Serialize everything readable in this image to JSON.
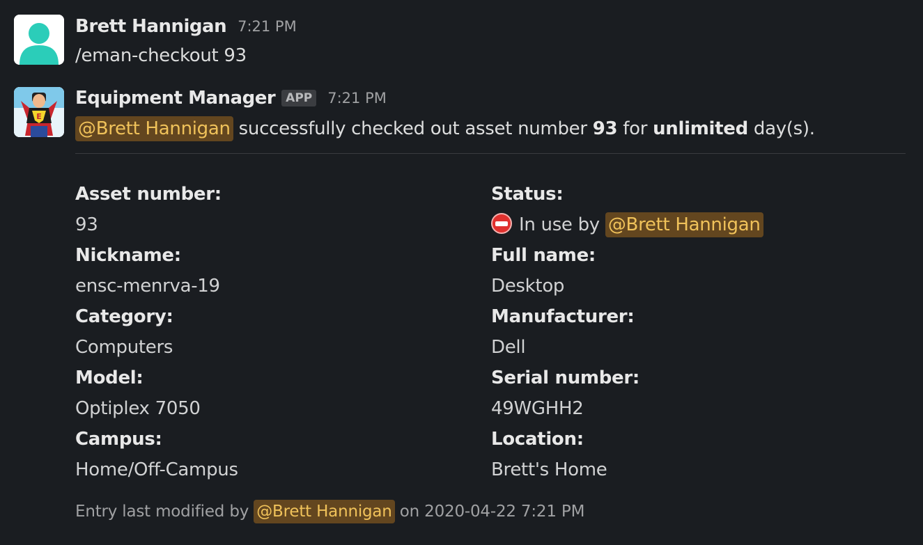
{
  "messages": [
    {
      "sender": "Brett Hannigan",
      "time": "7:21 PM",
      "text": "/eman-checkout 93"
    },
    {
      "sender": "Equipment Manager",
      "badge": "APP",
      "time": "7:21 PM",
      "mention": "@Brett Hannigan",
      "text_a": " successfully checked out asset number ",
      "asset_bold": "93",
      "text_b": " for ",
      "duration_bold": "unlimited",
      "text_c": " day(s)."
    }
  ],
  "fields": {
    "asset_number_label": "Asset number:",
    "asset_number_value": "93",
    "status_label": "Status:",
    "status_icon": "no-entry-icon",
    "status_text": "In use by ",
    "status_mention": "@Brett Hannigan",
    "nickname_label": "Nickname:",
    "nickname_value": "ensc-menrva-19",
    "full_name_label": "Full name:",
    "full_name_value": "Desktop",
    "category_label": "Category:",
    "category_value": "Computers",
    "manufacturer_label": "Manufacturer:",
    "manufacturer_value": "Dell",
    "model_label": "Model:",
    "model_value": "Optiplex 7050",
    "serial_label": "Serial number:",
    "serial_value": "49WGHH2",
    "campus_label": "Campus:",
    "campus_value": "Home/Off-Campus",
    "location_label": "Location:",
    "location_value": "Brett's Home"
  },
  "footer": {
    "prefix": "Entry last modified by ",
    "mention": "@Brett Hannigan",
    "suffix": " on 2020-04-22 7:21 PM"
  },
  "colors": {
    "background": "#1a1d21",
    "mention_text": "#f0c25a",
    "mention_bg": "#63461f",
    "status_red": "#e0312e"
  }
}
